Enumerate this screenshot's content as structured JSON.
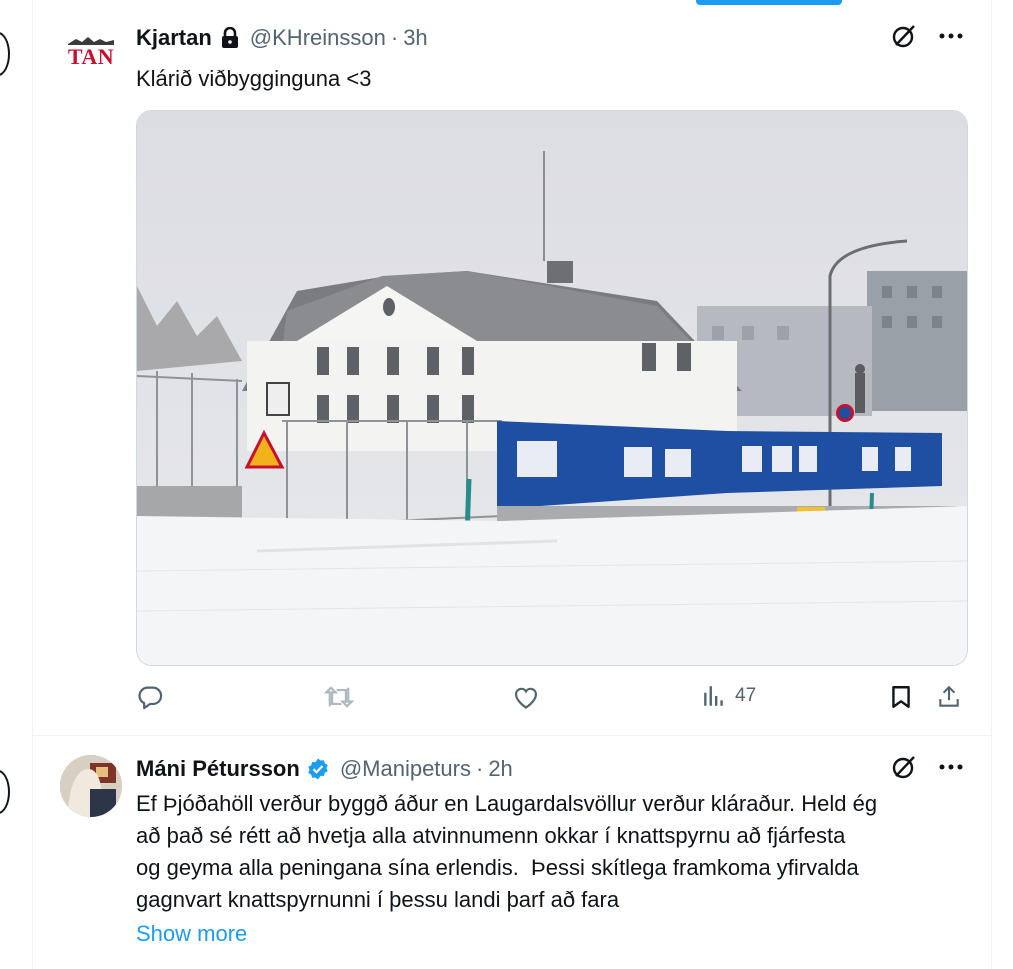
{
  "tweets": [
    {
      "author_name": "Kjartan",
      "handle": "@KHreinsson",
      "separator": "·",
      "time": "3h",
      "avatar_text": "TAN",
      "text": "Klárið viðbygginguna <3",
      "stats": {
        "views": "47"
      }
    },
    {
      "author_name": "Máni Pétursson",
      "handle": "@Manipeturs",
      "separator": "·",
      "time": "2h",
      "text_lines": [
        "Ef Þjóðahöll verður byggð áður en Laugardalsvöllur verður kláraður. Held ég",
        "að það sé rétt að hvetja alla atvinnumenn okkar í knattspyrnu að fjárfesta",
        "og geyma alla peningana sína erlendis.  Þessi skítlega framkoma yfirvalda",
        "gagnvart knattspyrnunni í þessu landi þarf að fara"
      ],
      "show_more": "Show more"
    }
  ],
  "colors": {
    "accent": "#1d9bf0",
    "text": "#0f1419",
    "muted": "#536471",
    "border": "#eff3f4",
    "verified": "#1d9bf0"
  },
  "icons": [
    "lock-icon",
    "verified-badge-icon",
    "grok-icon",
    "more-icon",
    "reply-icon",
    "retweet-icon",
    "like-icon",
    "views-icon",
    "bookmark-icon",
    "share-icon"
  ]
}
